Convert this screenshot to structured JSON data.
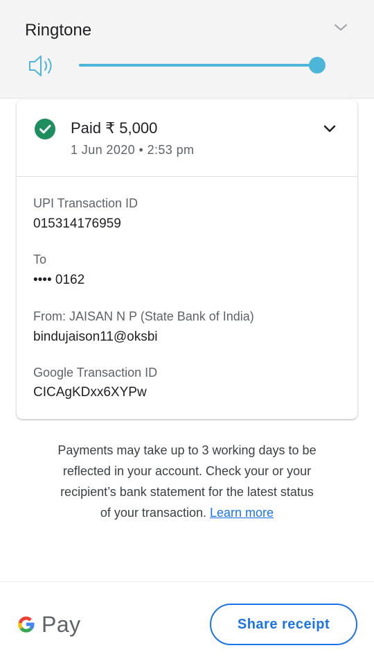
{
  "volume_panel": {
    "title": "Ringtone",
    "icons": {
      "speaker": "speaker-icon",
      "collapse": "chevron-down-icon"
    },
    "level": 1.0,
    "accent_color": "#4db6d8"
  },
  "transaction": {
    "status_icon": "check-circle-icon",
    "status_color": "#1e8e5e",
    "amount_text": "Paid ₹ 5,000",
    "timestamp": "1 Jun 2020 • 2:53 pm",
    "expand_icon": "chevron-down-icon",
    "fields": [
      {
        "label": "UPI Transaction ID",
        "value": "015314176959"
      },
      {
        "label": "To",
        "value": "•••• 0162"
      },
      {
        "label": "From: JAISAN  N P (State Bank of India)",
        "value": "bindujaison11@oksbi"
      },
      {
        "label": "Google Transaction ID",
        "value": "CICAgKDxx6XYPw"
      }
    ]
  },
  "info": {
    "text": "Payments may take up to 3 working days to be reflected in your account. Check your or your recipient’s bank statement for the latest status of your transaction.",
    "link": "Learn more",
    "link_color": "#1a73e8"
  },
  "footer": {
    "logo_text": "Pay",
    "share_button": "Share receipt"
  }
}
